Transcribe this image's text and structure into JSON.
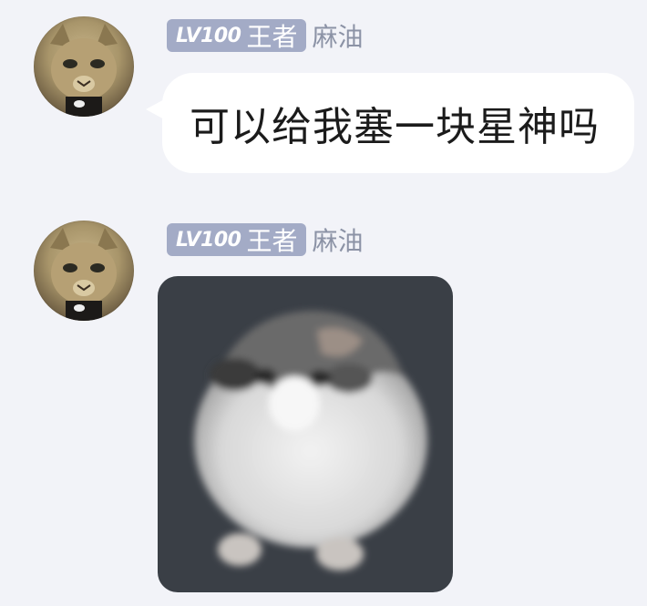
{
  "messages": [
    {
      "type": "text",
      "sender": {
        "level": "LV100",
        "title": "王者",
        "nickname": "麻油",
        "avatar_icon": "cat-avatar-icon"
      },
      "text": "可以给我塞一块星神吗"
    },
    {
      "type": "sticker",
      "sender": {
        "level": "LV100",
        "title": "王者",
        "nickname": "麻油",
        "avatar_icon": "cat-avatar-icon"
      },
      "sticker_icon": "round-cat-sticker-icon"
    }
  ],
  "colors": {
    "background": "#f2f3f8",
    "badge": "#a3abc6",
    "nickname": "#8c93a6",
    "bubble": "#ffffff",
    "sticker_bg": "#3a3f46"
  }
}
